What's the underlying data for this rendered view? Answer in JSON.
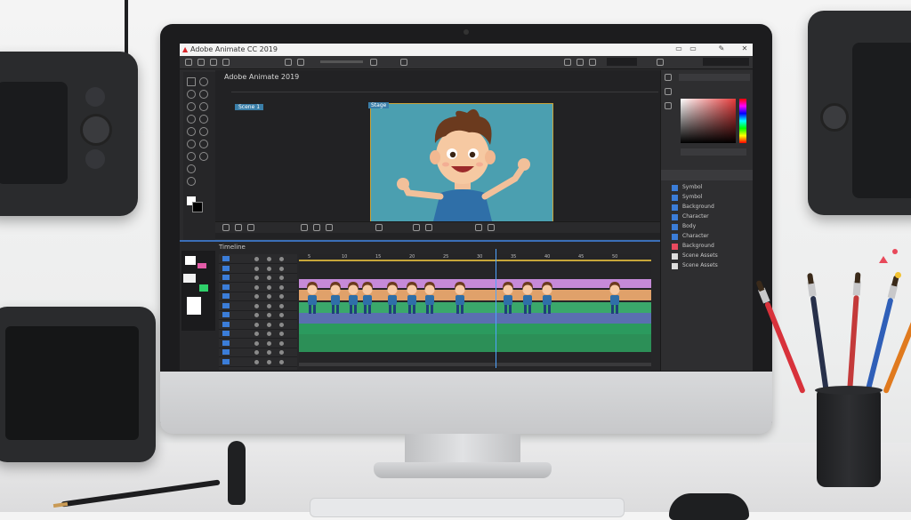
{
  "app": {
    "title": "Adobe Animate CC 2019",
    "document_name": "Adobe Animate 2019",
    "scene_label": "Scene 1",
    "stage_label": "Stage",
    "timeline_label": "Timeline",
    "colors": {
      "accent": "#3b6fb8",
      "stage_bg": "#4b9fb0",
      "logo_red": "#d9252a"
    }
  },
  "library": {
    "items": [
      "Symbol",
      "Symbol",
      "Background",
      "Character",
      "Body",
      "Character",
      "Background",
      "Scene Assets",
      "Scene Assets"
    ],
    "icon_colors": [
      "#3b7dd8",
      "#3b7dd8",
      "#3b7dd8",
      "#3b7dd8",
      "#3b7dd8",
      "#3b7dd8",
      "#e84a5f",
      "#dddddd",
      "#dddddd"
    ]
  },
  "timeline": {
    "frame_marks": [
      "5",
      "10",
      "15",
      "20",
      "25",
      "30",
      "35",
      "40",
      "45",
      "50"
    ],
    "band_colors": [
      "#c68ad8",
      "#e0a16a",
      "#3aa86b",
      "#5a6fb0",
      "#2b9a5e",
      "#2c8f57"
    ]
  }
}
